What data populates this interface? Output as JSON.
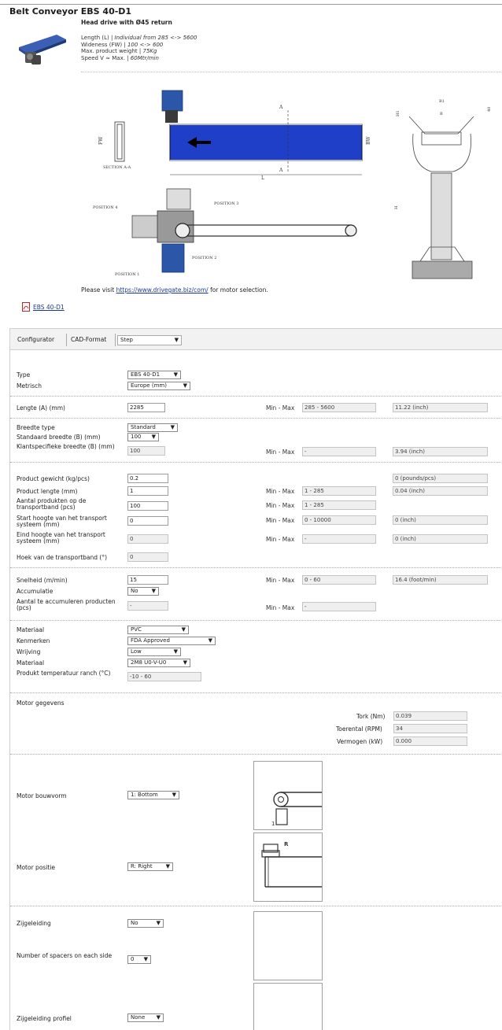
{
  "header": {
    "title": "Belt Conveyor EBS 40-D1",
    "subtitle": "Head drive with Ø45 return",
    "specs": [
      {
        "label": "Length (L) | ",
        "value": "Individual from 285 <-> 5600"
      },
      {
        "label": "Wideness (FW) | ",
        "value": "100 <-> 600"
      },
      {
        "label": "Max. product weight | ",
        "value": "75Kg"
      },
      {
        "label": "Speed V ≈ Max. | ",
        "value": "60Mtr/min"
      }
    ]
  },
  "drawing_labels": {
    "section": "SECTION A-A",
    "fw": "FW",
    "bw": "BW",
    "a": "A",
    "l": "L",
    "pos1": "POSITION 1",
    "pos2": "POSITION 2",
    "pos3": "POSITION 3",
    "pos4": "POSITION 4",
    "b1": "B1",
    "b": "B",
    "h1": "H1",
    "h": "H",
    "forty": "40"
  },
  "visit": {
    "prefix": "Please visit ",
    "link": "https://www.drivegate.biz/com/",
    "suffix": " for motor selection."
  },
  "pdf_link": "EBS 40-D1",
  "tabs": {
    "configurator": "Configurator",
    "cad_label": "CAD-Format",
    "cad_value": "Step"
  },
  "minmax": "Min - Max",
  "form": {
    "type_label": "Type",
    "type_value": "EBS 40-D1",
    "metric_label": "Metrisch",
    "metric_value": "Europe (mm)",
    "length_label": "Lengte (A) (mm)",
    "length_value": "2285",
    "length_range": "285 - 5600",
    "length_inch": "11.22  (inch)",
    "width_type_label": "Breedte type",
    "width_type_value": "Standard",
    "std_width_label": "Standaard breedte (B) (mm)",
    "std_width_value": "100",
    "cust_width_label": "Klantspecifieke breedte (B) (mm)",
    "cust_width_value": "100",
    "cust_width_range": "-",
    "cust_width_inch": "3.94  (inch)",
    "weight_label": "Product gewicht (kg/pcs)",
    "weight_value": "0.2",
    "weight_conv": "0  (pounds/pcs)",
    "plen_label": "Product lengte (mm)",
    "plen_value": "1",
    "plen_range": "1 - 285",
    "plen_inch": "0.04  (inch)",
    "count_label": "Aantal produkten op de transportband (pcs)",
    "count_value": "100",
    "count_range": "1 - 285",
    "start_h_label": "Start hoogte van het transport systeem (mm)",
    "start_h_value": "0",
    "start_h_range": "0 - 10000",
    "start_h_inch": "0  (inch)",
    "end_h_label": "Eind hoogte van het transport systeem (mm)",
    "end_h_value": "0",
    "end_h_range": "-",
    "end_h_inch": "0  (inch)",
    "angle_label": "Hoek van de transportband (°)",
    "angle_value": "0",
    "speed_label": "Snelheid (m/min)",
    "speed_value": "15",
    "speed_range": "0 - 60",
    "speed_conv": "16.4  (foot/min)",
    "accum_label": "Accumulatie",
    "accum_value": "No",
    "accum_count_label": "Aantal te accumuleren producten (pcs)",
    "accum_count_value": "-",
    "accum_count_range": "-",
    "material_label": "Materiaal",
    "material_value": "PVC",
    "marks_label": "Kenmerken",
    "marks_value": "FDA Approved",
    "friction_label": "Wrijving",
    "friction_value": "Low",
    "material2_label": "Materiaal",
    "material2_value": "2M8 U0-V-U0",
    "temp_label": "Produkt temperatuur ranch (°C)",
    "temp_value": "-10 - 60",
    "motor_section": "Motor gegevens",
    "torque_label": "Tork (Nm)",
    "torque_value": "0.039",
    "rpm_label": "Toerental (RPM)",
    "rpm_value": "34",
    "power_label": "Vermogen (kW)",
    "power_value": "0.000",
    "motor_form_label": "Motor bouwvorm",
    "motor_form_value": "1: Bottom",
    "motor_pos_label": "Motor positie",
    "motor_pos_value": "R: Right",
    "motor_img_1_text": "1",
    "motor_img_2_text": "R",
    "side_guide_label": "Zijgeleiding",
    "side_guide_value": "No",
    "spacers_label": "Number of spacers on each side",
    "spacers_value": "0",
    "guide_profile_label": "Zijgeleiding profiel",
    "guide_profile_value": "None"
  }
}
